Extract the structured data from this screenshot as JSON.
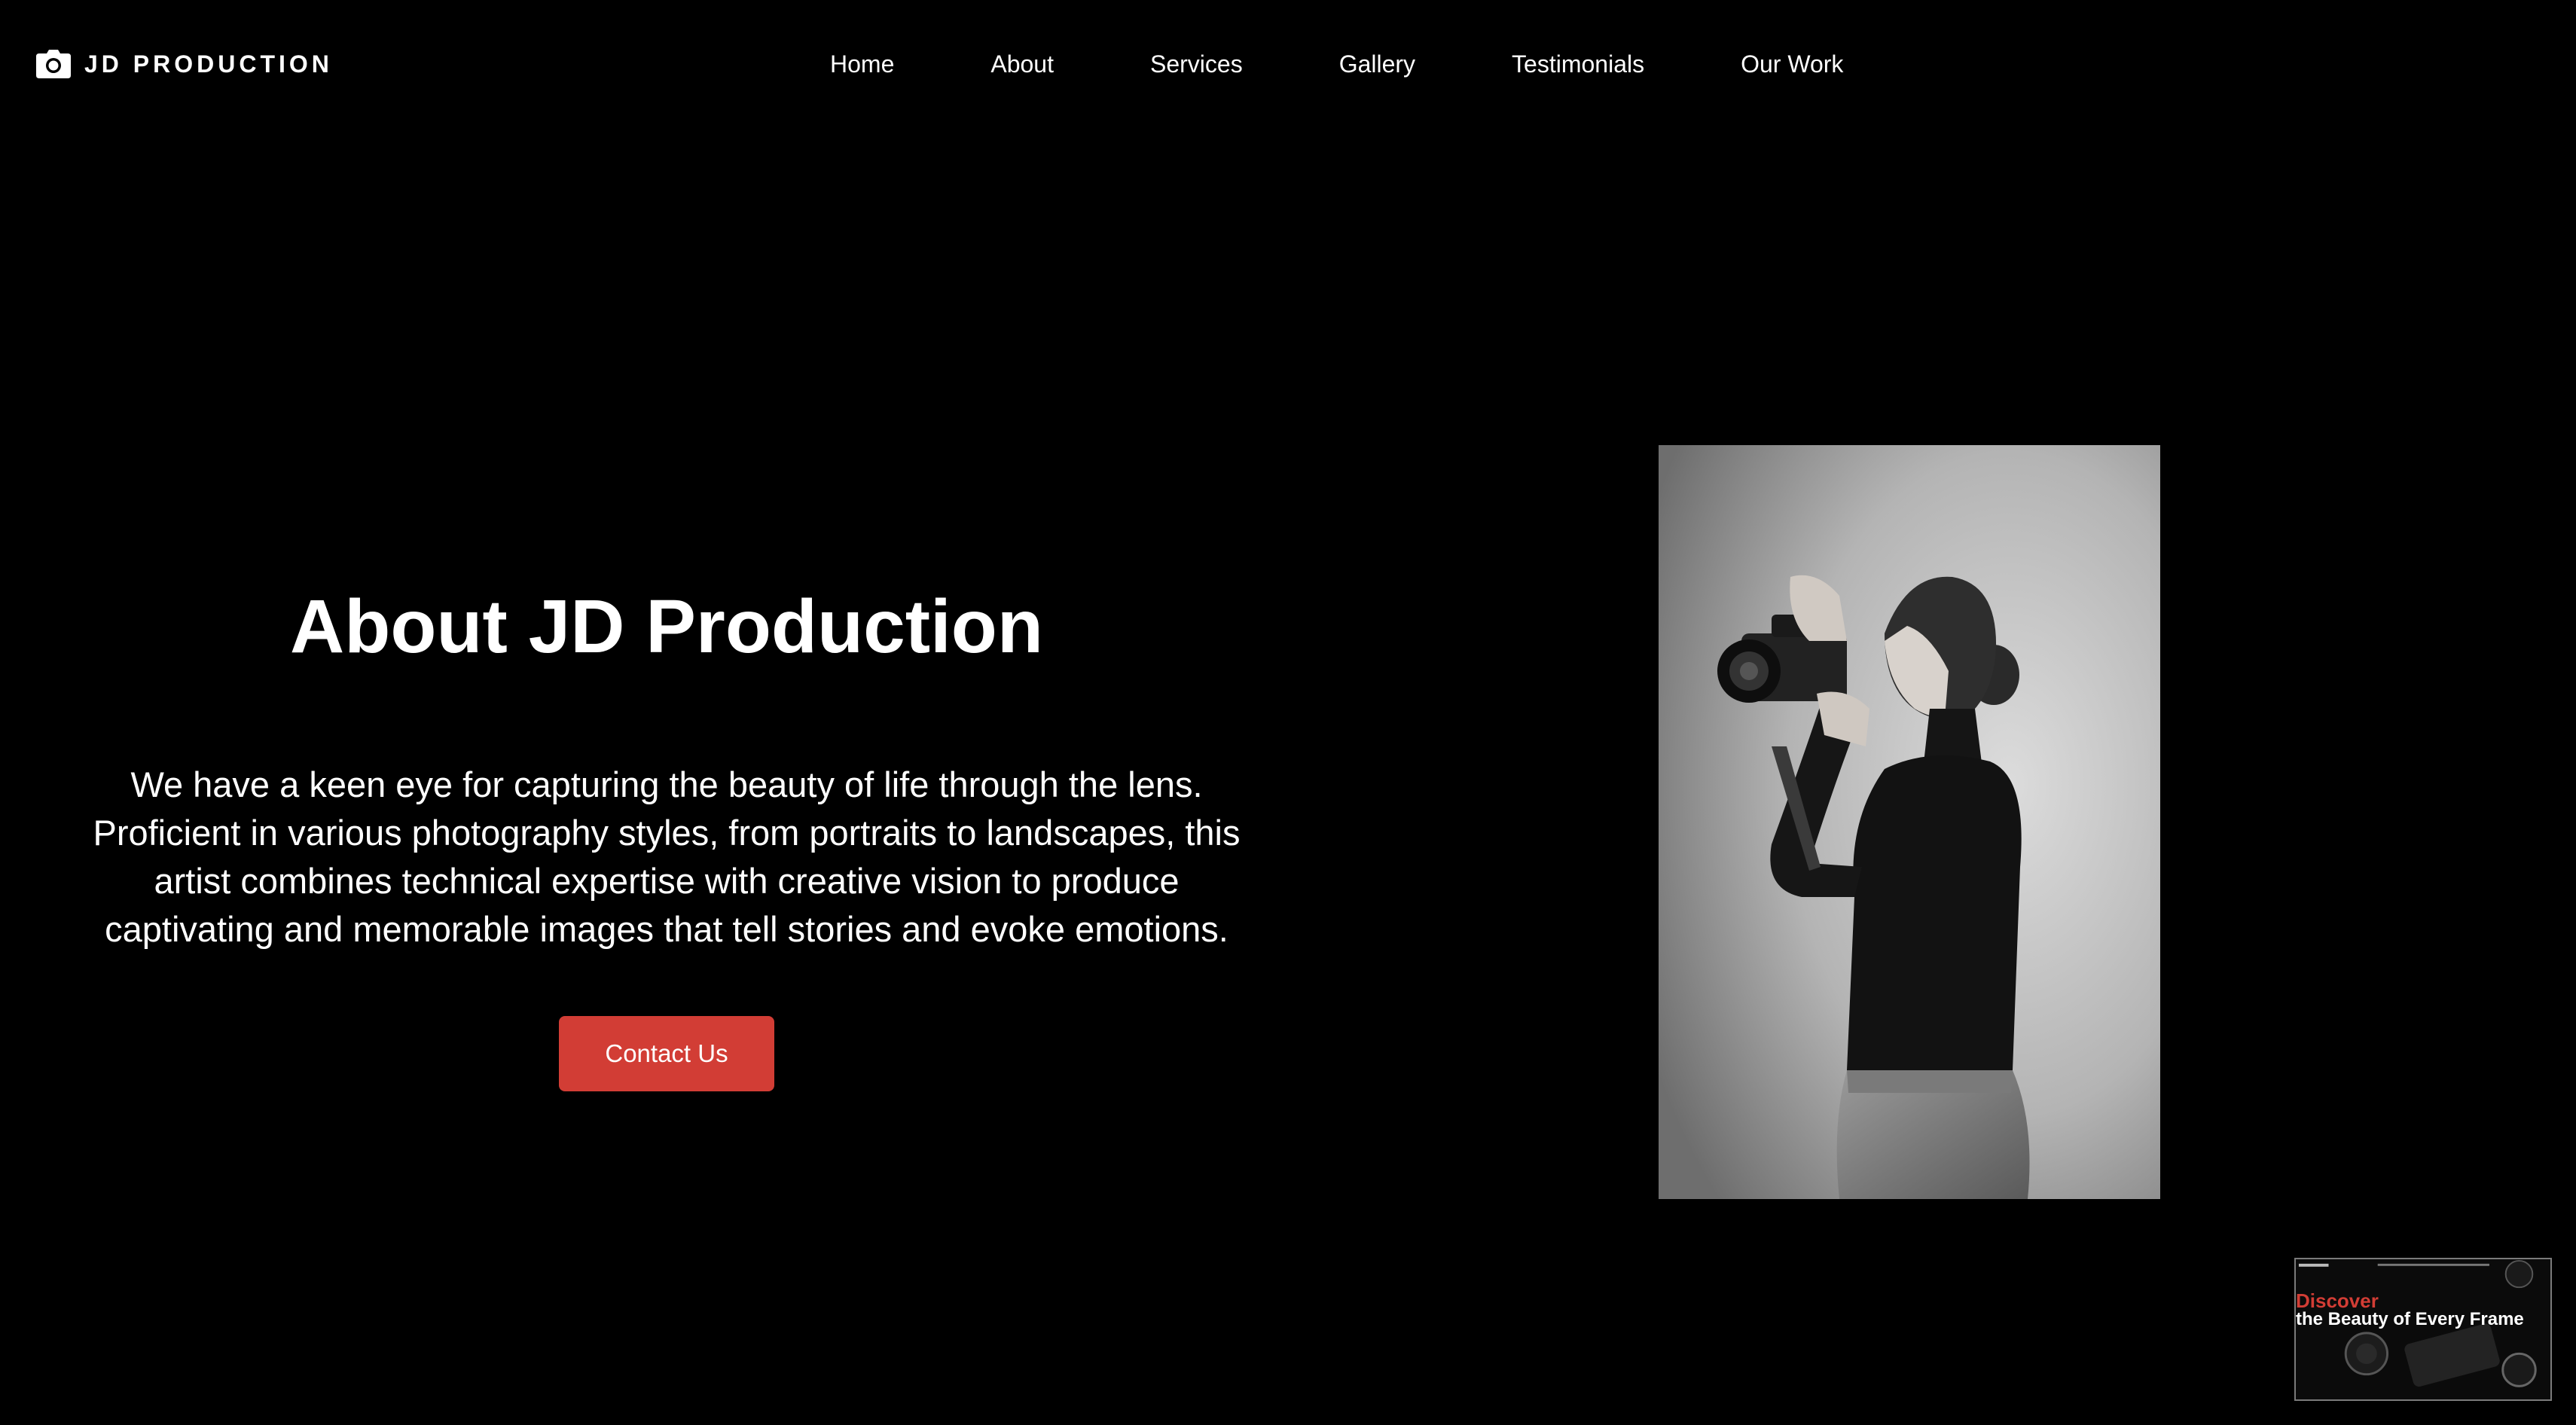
{
  "brand": {
    "name": "JD PRODUCTION",
    "icon": "camera-icon"
  },
  "nav": {
    "items": [
      {
        "label": "Home"
      },
      {
        "label": "About"
      },
      {
        "label": "Services"
      },
      {
        "label": "Gallery"
      },
      {
        "label": "Testimonials"
      },
      {
        "label": "Our Work"
      }
    ]
  },
  "about": {
    "title": "About JD Production",
    "lines": [
      "We have a keen eye for capturing the beauty of life through the lens.",
      "Proficient in various photography styles, from portraits to landscapes, this",
      "artist combines technical expertise with creative vision to produce",
      "captivating and memorable images that tell stories and evoke emotions."
    ],
    "cta_label": "Contact Us"
  },
  "thumbnail": {
    "discover": "Discover",
    "tagline": "the Beauty of Every Frame"
  },
  "colors": {
    "background": "#000000",
    "accent": "#d23d35",
    "text": "#ffffff"
  }
}
